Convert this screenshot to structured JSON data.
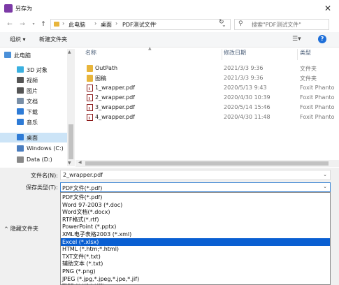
{
  "window": {
    "title": "另存为",
    "close_glyph": "✕"
  },
  "address": {
    "crumbs": [
      "此电脑",
      "桌面",
      "PDF测试文件"
    ],
    "search_placeholder": "搜索\"PDF测试文件\""
  },
  "toolbar": {
    "organize": "组织 ▾",
    "new_folder": "新建文件夹"
  },
  "nav": {
    "items": [
      {
        "label": "此电脑",
        "icon": "computer-icon",
        "color": "#4a90d9"
      },
      {
        "label": "3D 对象",
        "icon": "3d-objects-icon",
        "color": "#3ab0e0"
      },
      {
        "label": "视频",
        "icon": "video-icon",
        "color": "#555555"
      },
      {
        "label": "图片",
        "icon": "pictures-icon",
        "color": "#555555"
      },
      {
        "label": "文档",
        "icon": "documents-icon",
        "color": "#7a8fa6"
      },
      {
        "label": "下载",
        "icon": "downloads-icon",
        "color": "#2e7bd6"
      },
      {
        "label": "音乐",
        "icon": "music-icon",
        "color": "#2e7bd6"
      },
      {
        "label": "桌面",
        "icon": "desktop-icon",
        "color": "#2e7bd6"
      },
      {
        "label": "Windows (C:)",
        "icon": "drive-c-icon",
        "color": "#4a7dbf"
      },
      {
        "label": "Data (D:)",
        "icon": "drive-d-icon",
        "color": "#888888"
      }
    ],
    "selected": "桌面"
  },
  "columns": {
    "name": "名称",
    "date": "修改日期",
    "type": "类型"
  },
  "files": [
    {
      "name": "OutPath",
      "date": "2021/3/3 9:36",
      "type": "文件夹",
      "kind": "folder"
    },
    {
      "name": "图稿",
      "date": "2021/3/3 9:36",
      "type": "文件夹",
      "kind": "folder"
    },
    {
      "name": "1_wrapper.pdf",
      "date": "2020/5/13 9:43",
      "type": "Foxit Phanto",
      "kind": "pdf"
    },
    {
      "name": "2_wrapper.pdf",
      "date": "2020/4/30 10:39",
      "type": "Foxit Phanto",
      "kind": "pdf"
    },
    {
      "name": "3_wrapper.pdf",
      "date": "2020/5/14 15:46",
      "type": "Foxit Phanto",
      "kind": "pdf"
    },
    {
      "name": "4_wrapper.pdf",
      "date": "2020/4/30 11:48",
      "type": "Foxit Phanto",
      "kind": "pdf"
    }
  ],
  "form": {
    "filename_label": "文件名(N):",
    "filename_value": "2_wrapper.pdf",
    "type_label": "保存类型(T):",
    "type_value": "PDF文件(*.pdf)"
  },
  "hide_folders": "隐藏文件夹",
  "type_options": [
    "PDF文件(*.pdf)",
    "Word 97-2003 (*.doc)",
    "Word文档(*.docx)",
    "RTF格式(*.rtf)",
    "PowerPoint (*.pptx)",
    "XML电子表格2003 (*.xml)",
    "Excel (*.xlsx)",
    "HTML (*.htm;*.html)",
    "TXT文件(*.txt)",
    "辅助文本 (*.txt)",
    "PNG (*.png)",
    "JPEG (*.jpg,*.jpeg,*.jpe,*.jif)",
    "TIFF (*.tif;*.tiff)"
  ],
  "highlighted_option": "Excel (*.xlsx)",
  "colors": {
    "accent": "#0a5fd2",
    "selection": "#cce4f7"
  }
}
